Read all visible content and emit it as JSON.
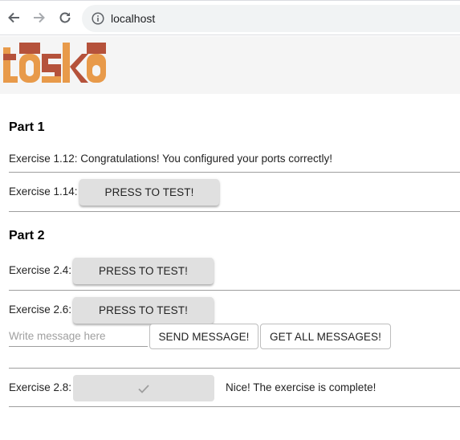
{
  "browser": {
    "url": "localhost"
  },
  "header": {
    "logo_text": "toska",
    "colors": {
      "header_bg": "#f5f5f5",
      "logo_light": "#e89a4a",
      "logo_dark": "#b5523b"
    }
  },
  "part1": {
    "title": "Part 1",
    "ex_1_12": "Exercise 1.12: Congratulations! You configured your ports correctly!",
    "ex_1_14_label": "Exercise 1.14:",
    "ex_1_14_button": "PRESS TO TEST!"
  },
  "part2": {
    "title": "Part 2",
    "ex_2_4_label": "Exercise 2.4:",
    "ex_2_4_button": "PRESS TO TEST!",
    "ex_2_6_label": "Exercise 2.6:",
    "ex_2_6_button": "PRESS TO TEST!",
    "message_placeholder": "Write message here",
    "send_button": "SEND MESSAGE!",
    "get_all_button": "GET ALL MESSAGES!",
    "ex_2_8_label": "Exercise 2.8:",
    "ex_2_8_status": "Nice! The exercise is complete!"
  }
}
